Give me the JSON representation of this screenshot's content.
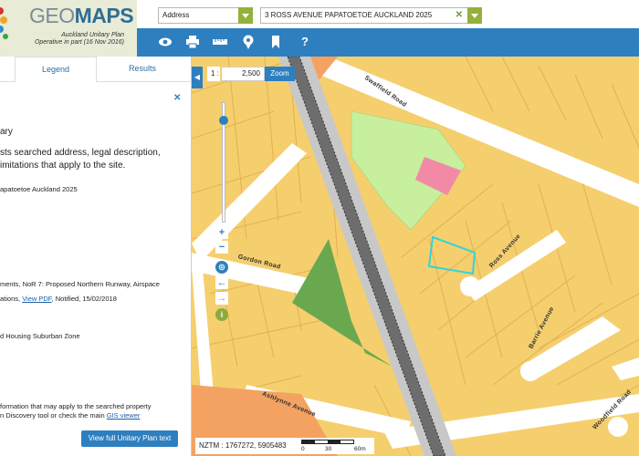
{
  "app": {
    "logo_prefix": "GEO",
    "logo_main": "MAPS",
    "logo_sub1": "Auckland Unitary Plan",
    "logo_sub2": "Operative in part (16 Nov 2016)"
  },
  "search": {
    "type_value": "Address",
    "query_value": "3 ROSS AVENUE PAPATOETOE AUCKLAND 2025",
    "clear_glyph": "✕"
  },
  "toolbar": {
    "icons": [
      "eye-icon",
      "print-icon",
      "ruler-icon",
      "location-pin-icon",
      "bookmark-icon",
      "help-icon"
    ],
    "help_glyph": "?"
  },
  "panel": {
    "tabs": [
      "Legend",
      "Results"
    ],
    "close_glyph": "✕",
    "heading": "ary",
    "intro_line1": "sts searched address, legal description,",
    "intro_line2": "imitations that apply to the site.",
    "address_fragment": "apatoetoe Auckland 2025",
    "overlay_fragment": "ments, NoR 7: Proposed Northern Runway, Airspace",
    "modification_prefix": "ations, ",
    "view_pdf": "View PDF",
    "modification_suffix": ", Notified, 15/02/2018",
    "zone_fragment": "d Housing Suburban Zone",
    "footer_line1": "formation that may apply to the searched property",
    "footer_line2_prefix": "n Discovery tool or check the main ",
    "gis_viewer": "GIS viewer",
    "view_button": "View full Unitary Plan text"
  },
  "map": {
    "scale_prefix": "1 :",
    "scale_value": "2,500",
    "zoom_button": "Zoom",
    "coords": "NZTM : 1767272, 5905483",
    "scale_ticks": [
      "0",
      "30",
      "60m"
    ],
    "roads": [
      "Swaffield Road",
      "Gordon Road",
      "Ross Avenue",
      "Barrie Avenue",
      "Ashlynne Avenue",
      "Woodfield Road"
    ],
    "colors": {
      "residential": "#f5cf6e",
      "lot_outline": "#e0b24f",
      "road": "#ffffff",
      "rail_corridor": "#c8c8c8",
      "open_space": "#6aa84f",
      "light_green": "#c7ef9e",
      "pink": "#f28aa6",
      "orange": "#f4a261",
      "selected_parcel": "#32d4d8",
      "accent_blue": "#2e7fbf"
    }
  }
}
